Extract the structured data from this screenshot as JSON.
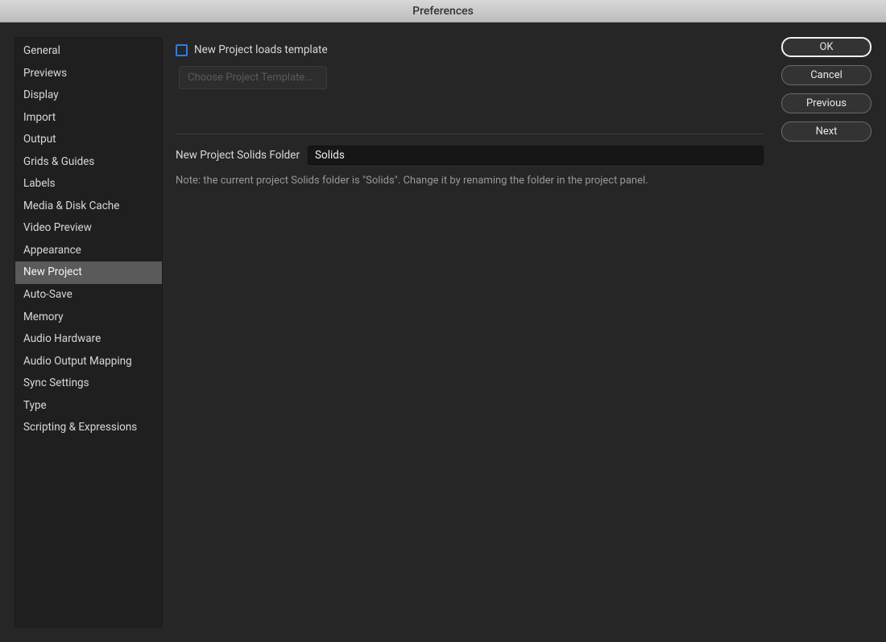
{
  "window": {
    "title": "Preferences"
  },
  "sidebar": {
    "items": [
      {
        "label": "General"
      },
      {
        "label": "Previews"
      },
      {
        "label": "Display"
      },
      {
        "label": "Import"
      },
      {
        "label": "Output"
      },
      {
        "label": "Grids & Guides"
      },
      {
        "label": "Labels"
      },
      {
        "label": "Media & Disk Cache"
      },
      {
        "label": "Video Preview"
      },
      {
        "label": "Appearance"
      },
      {
        "label": "New Project"
      },
      {
        "label": "Auto-Save"
      },
      {
        "label": "Memory"
      },
      {
        "label": "Audio Hardware"
      },
      {
        "label": "Audio Output Mapping"
      },
      {
        "label": "Sync Settings"
      },
      {
        "label": "Type"
      },
      {
        "label": "Scripting & Expressions"
      }
    ],
    "selected_index": 10
  },
  "content": {
    "loads_template": {
      "label": "New Project loads template",
      "checked": false
    },
    "choose_template_button": "Choose Project Template...",
    "solids_folder": {
      "label": "New Project Solids Folder",
      "value": "Solids"
    },
    "note": "Note: the current project Solids folder is \"Solids\". Change it by renaming the folder in the project panel."
  },
  "buttons": {
    "ok": "OK",
    "cancel": "Cancel",
    "previous": "Previous",
    "next": "Next"
  }
}
